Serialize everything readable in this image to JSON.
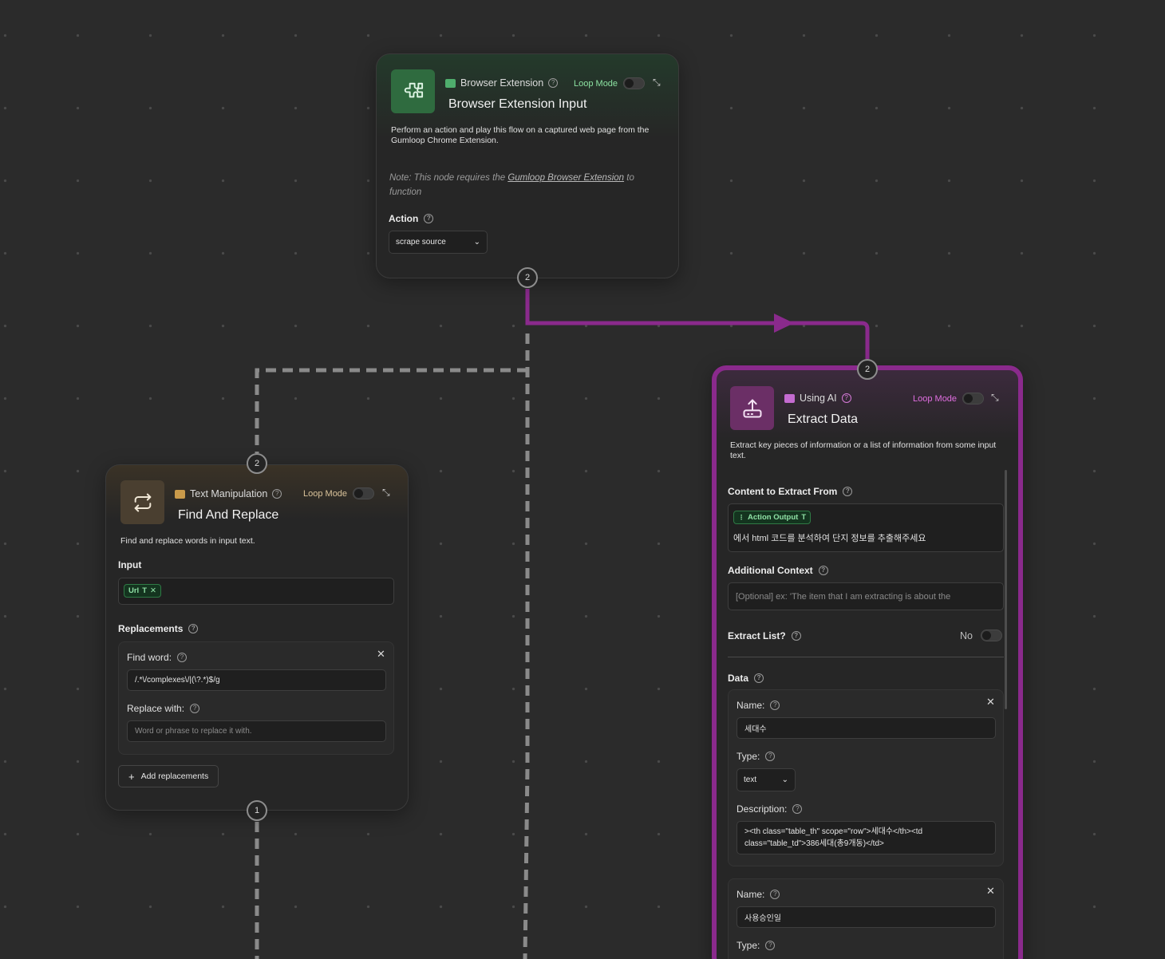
{
  "browser_node": {
    "category": "Browser Extension",
    "loop_mode_label": "Loop Mode",
    "title": "Browser Extension Input",
    "description": "Perform an action and play this flow on a captured web page from the Gumloop Chrome Extension.",
    "note_prefix": "Note: This node requires the",
    "note_link": "Gumloop Browser Extension",
    "note_suffix": "to function",
    "action_label": "Action",
    "action_value": "scrape source",
    "output_port": "2"
  },
  "find_replace_node": {
    "input_port": "2",
    "category": "Text Manipulation",
    "loop_mode_label": "Loop Mode",
    "title": "Find And Replace",
    "description": "Find and replace words in input text.",
    "input_label": "Input",
    "input_chip": "Url",
    "replacements_label": "Replacements",
    "find_word_label": "Find word:",
    "find_word_value": "/.*\\/complexes\\/|(\\?.*)$/g",
    "replace_with_label": "Replace with:",
    "replace_with_placeholder": "Word or phrase to replace it with.",
    "add_button": "Add replacements",
    "output_port": "1"
  },
  "extract_node": {
    "input_port": "2",
    "category": "Using AI",
    "loop_mode_label": "Loop Mode",
    "title": "Extract Data",
    "description": "Extract key pieces of information or a list of information from some input text.",
    "content_label": "Content to Extract From",
    "content_chip": "Action Output",
    "content_text": "에서 html 코드를 분석하여 단지 정보를 추출해주세요",
    "context_label": "Additional Context",
    "context_placeholder": "[Optional] ex: 'The item that I am extracting is about the",
    "extract_list_label": "Extract List?",
    "extract_list_value": "No",
    "data_label": "Data",
    "items": [
      {
        "name_label": "Name:",
        "name_value": "세대수",
        "type_label": "Type:",
        "type_value": "text",
        "desc_label": "Description:",
        "desc_value": "><th class=\"table_th\" scope=\"row\">세대수</th><td class=\"table_td\">386세대(총9개동)</td>"
      },
      {
        "name_label": "Name:",
        "name_value": "사용승인일",
        "type_label": "Type:"
      }
    ]
  },
  "colors": {
    "accent_purple": "#8a2a8c",
    "loop_green": "#8be0a0",
    "loop_tan": "#d9c29a",
    "loop_pink": "#e06ee0",
    "edge_gray": "#8a8a8a"
  }
}
